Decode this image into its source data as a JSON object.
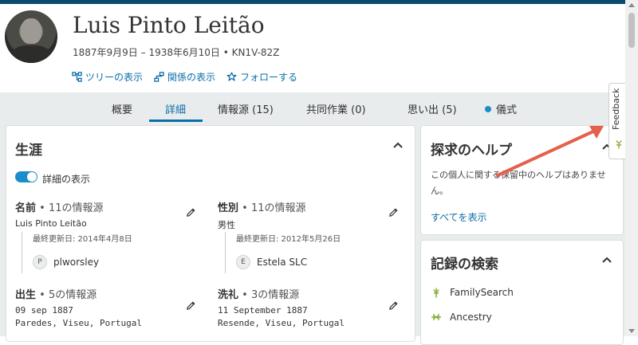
{
  "person": {
    "name": "Luis Pinto Leitão",
    "lifespan": "1887年9月9日 – 1938年6月10日 •  KN1V-82Z"
  },
  "actions": [
    {
      "label": "ツリーの表示",
      "icon": "tree-icon"
    },
    {
      "label": "関係の表示",
      "icon": "relationship-icon"
    },
    {
      "label": "フォローする",
      "icon": "star-icon"
    }
  ],
  "tabs": [
    {
      "label": "概要"
    },
    {
      "label": "詳細"
    },
    {
      "label": "情報源 (15)"
    },
    {
      "label": "共同作業 (0)"
    },
    {
      "label": "思い出 (5)"
    },
    {
      "label": "儀式"
    }
  ],
  "vitals": {
    "title": "生涯",
    "toggle_label": "詳細の表示",
    "name": {
      "label": "名前",
      "sources": " • 11の情報源",
      "value": "Luis Pinto Leitão",
      "updated": "最終更新日: 2014年4月8日",
      "contributor_initial": "P",
      "contributor": "plworsley"
    },
    "sex": {
      "label": "性別",
      "sources": " • 11の情報源",
      "value": "男性",
      "updated": "最終更新日: 2012年5月26日",
      "contributor_initial": "E",
      "contributor": "Estela SLC"
    },
    "birth": {
      "label": "出生",
      "sources": " • 5の情報源",
      "date": "09 sep 1887",
      "place": "Paredes, Viseu, Portugal"
    },
    "christening": {
      "label": "洗礼",
      "sources": " • 3の情報源",
      "date": "11 September 1887",
      "place": "Resende, Viseu, Portugal"
    }
  },
  "research_help": {
    "title": "探求のヘルプ",
    "text": "この個人に関する保留中のヘルプはありません。",
    "show_all": "すべてを表示"
  },
  "record_search": {
    "title": "記録の検索",
    "items": [
      {
        "label": "FamilySearch",
        "icon": "familysearch-tree-icon"
      },
      {
        "label": "Ancestry",
        "icon": "ancestry-icon"
      }
    ]
  },
  "feedback": {
    "label": "Feedback"
  },
  "colors": {
    "accent": "#0b6ea8",
    "topbar": "#0a4a6e",
    "tabs_bg": "#e9ecec",
    "arrow": "#e5604a"
  }
}
